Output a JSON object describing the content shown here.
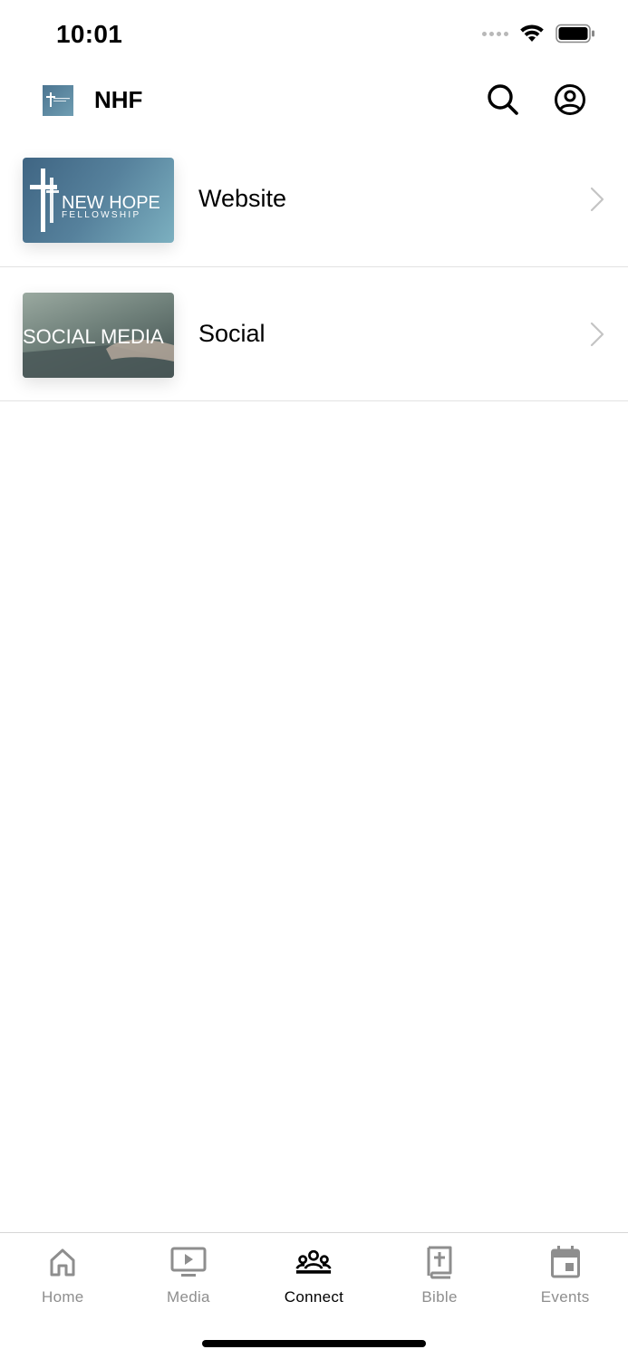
{
  "status_bar": {
    "time": "10:01"
  },
  "header": {
    "title": "NHF",
    "logo_text": "NEW HOPE"
  },
  "list": [
    {
      "label": "Website",
      "thumb_line1": "NEW HOPE",
      "thumb_line2": "FELLOWSHIP"
    },
    {
      "label": "Social",
      "thumb_text": "SOCIAL MEDIA"
    }
  ],
  "tabs": [
    {
      "label": "Home",
      "icon": "home-icon"
    },
    {
      "label": "Media",
      "icon": "media-icon"
    },
    {
      "label": "Connect",
      "icon": "connect-icon",
      "active": true
    },
    {
      "label": "Bible",
      "icon": "bible-icon"
    },
    {
      "label": "Events",
      "icon": "events-icon"
    }
  ],
  "colors": {
    "active": "#000000",
    "inactive": "#8e8e8e",
    "divider": "#e2e2e2"
  }
}
